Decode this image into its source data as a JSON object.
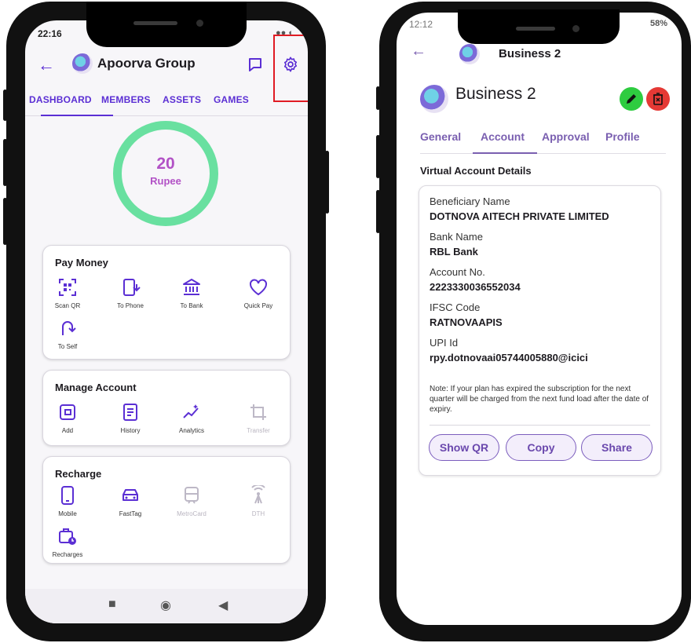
{
  "group_screen": {
    "status_time": "22:16",
    "title": "Apoorva Group",
    "tabs": [
      "DASHBOARD",
      "MEMBERS",
      "ASSETS",
      "GAMES"
    ],
    "balance": {
      "amount": "20",
      "currency": "Rupee"
    },
    "pay_money": {
      "title": "Pay Money",
      "items": [
        {
          "label": "Scan QR",
          "icon": "qr-scan-icon"
        },
        {
          "label": "To Phone",
          "icon": "phone-transfer-icon"
        },
        {
          "label": "To Bank",
          "icon": "bank-icon"
        },
        {
          "label": "Quick Pay",
          "icon": "heart-icon"
        },
        {
          "label": "To Self",
          "icon": "self-transfer-icon"
        }
      ]
    },
    "manage_account": {
      "title": "Manage Account",
      "items": [
        {
          "label": "Add",
          "icon": "wallet-add-icon"
        },
        {
          "label": "History",
          "icon": "receipt-icon"
        },
        {
          "label": "Analytics",
          "icon": "sparkle-icon"
        },
        {
          "label": "Transfer",
          "icon": "crop-icon",
          "disabled": true
        }
      ]
    },
    "recharge": {
      "title": "Recharge",
      "items": [
        {
          "label": "Mobile",
          "icon": "mobile-icon"
        },
        {
          "label": "FastTag",
          "icon": "car-icon"
        },
        {
          "label": "MetroCard",
          "icon": "train-icon",
          "disabled": true
        },
        {
          "label": "DTH",
          "icon": "antenna-icon",
          "disabled": true
        },
        {
          "label": "Recharges",
          "icon": "recharge-history-icon"
        }
      ]
    },
    "colors": {
      "accent": "#5b2fd4",
      "ring": "#69e0a0",
      "balance_text": "#b252c6",
      "highlight": "#e01b24"
    }
  },
  "business_screen": {
    "status_time": "12:12",
    "status_battery": "58%",
    "appbar_title": "Business 2",
    "header_title": "Business 2",
    "tabs": [
      "General",
      "Account",
      "Approval",
      "Profile"
    ],
    "active_tab": "Account",
    "section_title": "Virtual Account Details",
    "fields": [
      {
        "label": "Beneficiary Name",
        "value": "DOTNOVA AITECH PRIVATE LIMITED"
      },
      {
        "label": "Bank Name",
        "value": "RBL Bank"
      },
      {
        "label": "Account No.",
        "value": "2223330036552034"
      },
      {
        "label": "IFSC Code",
        "value": "RATNOVAAPIS"
      },
      {
        "label": "UPI Id",
        "value": "rpy.dotnovaai05744005880@icici"
      }
    ],
    "note": "Note: If your plan has expired the subscription for the next quarter will be charged from the next fund load after the date of expiry.",
    "buttons": [
      "Show QR",
      "Copy",
      "Share"
    ],
    "colors": {
      "edit": "#2ecc40",
      "delete": "#e53935",
      "tab": "#7a5fb0"
    }
  }
}
